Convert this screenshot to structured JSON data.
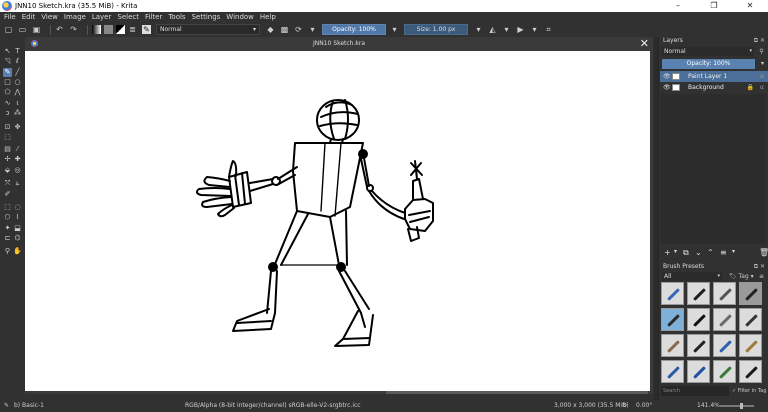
{
  "window": {
    "title": "JNN10 Sketch.kra (35.5 MiB)  - Krita",
    "controls": [
      "–",
      "❐",
      "✕"
    ]
  },
  "menu": [
    "File",
    "Edit",
    "View",
    "Image",
    "Layer",
    "Select",
    "Filter",
    "Tools",
    "Settings",
    "Window",
    "Help"
  ],
  "tool_options": {
    "blend_mode": "Normal",
    "opacity_label": "Opacity: 100%",
    "opacity_fraction": 1.0,
    "size_label": "Size: 1.00 px"
  },
  "document": {
    "tab_title": "JNN10 Sketch.kra",
    "close_glyph": "✕"
  },
  "layers_docker": {
    "title": "Layers",
    "blend_mode": "Normal",
    "opacity_label": "Opacity:  100%",
    "layers": [
      {
        "name": "Paint Layer 1",
        "selected": true
      },
      {
        "name": "Background",
        "selected": false
      }
    ]
  },
  "presets_docker": {
    "title": "Brush Presets",
    "filter_value": "All",
    "tag_label": "Tag",
    "search_placeholder": "Search",
    "filter_in_tag": "Filter in Tag"
  },
  "statusbar": {
    "brush": "b) Basic-1",
    "color_profile": "RGB/Alpha (8-bit integer/channel)  sRGB-elle-V2-srgbtrc.icc",
    "image_size": "3,000 x 3,000 (35.5 MiB)",
    "zoom": "141.4%",
    "rotation": "0.00°"
  },
  "colors": {
    "accent": "#5a82b0",
    "panel": "#313131",
    "canvas": "#ffffff"
  }
}
